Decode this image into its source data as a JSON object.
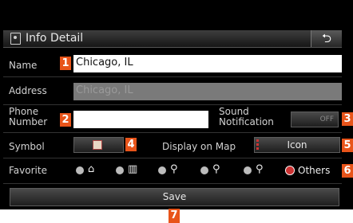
{
  "header": {
    "title": "Info Detail",
    "back_symbol": "⮌"
  },
  "fields": {
    "name_label": "Name",
    "name_value": "Chicago, IL",
    "address_label": "Address",
    "address_value": "Chicago, IL",
    "phone_label_line1": "Phone",
    "phone_label_line2": "Number",
    "phone_value": "",
    "sound_label_line1": "Sound",
    "sound_label_line2": "Notification",
    "sound_toggle": "OFF",
    "symbol_label": "Symbol",
    "display_label": "Display on Map",
    "display_value": "Icon",
    "favorite_label": "Favorite",
    "favorite_others": "Others"
  },
  "favorite_options": [
    {
      "icon": "home-icon",
      "glyph": "⌂",
      "selected": false
    },
    {
      "icon": "office-icon",
      "glyph": "▥",
      "selected": false
    },
    {
      "icon": "pin-1-icon",
      "glyph": "⚲",
      "selected": false
    },
    {
      "icon": "pin-2-icon",
      "glyph": "⚲",
      "selected": false
    },
    {
      "icon": "pin-3-icon",
      "glyph": "⚲",
      "selected": false
    }
  ],
  "save_label": "Save",
  "callouts": [
    "1",
    "2",
    "3",
    "4",
    "5",
    "6",
    "7"
  ],
  "colors": {
    "callout": "#e8541a",
    "selected_radio": "#cc3333"
  }
}
